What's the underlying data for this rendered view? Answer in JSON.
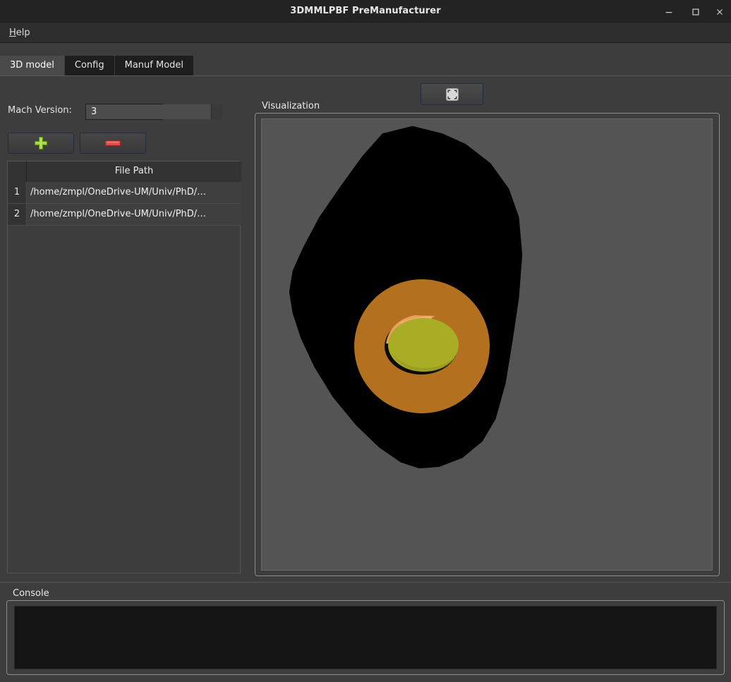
{
  "window": {
    "title": "3DMMLPBF PreManufacturer",
    "minimize_icon": "minimize-icon",
    "maximize_icon": "maximize-icon",
    "close_icon": "close-icon"
  },
  "menubar": {
    "items": [
      {
        "label": "Help",
        "mnemonic": "H",
        "rest": "elp"
      }
    ]
  },
  "tabs": [
    {
      "label": "3D model",
      "active": true
    },
    {
      "label": "Config",
      "active": false
    },
    {
      "label": "Manuf Model",
      "active": false
    }
  ],
  "left_panel": {
    "mach_version_label": "Mach Version:",
    "mach_version_value": "3",
    "mach_version_placeholder": "",
    "add_button": {
      "label": "",
      "icon": "plus-icon",
      "color": "#9fd636"
    },
    "remove_button": {
      "label": "",
      "icon": "minus-icon",
      "color": "#e04a4a"
    },
    "table": {
      "columns": [
        "",
        "File Path"
      ],
      "rows": [
        {
          "num": "1",
          "path": "/home/zmpl/OneDrive-UM/Univ/PhD/…"
        },
        {
          "num": "2",
          "path": "/home/zmpl/OneDrive-UM/Univ/PhD/…"
        }
      ]
    }
  },
  "toolbar": {
    "fit_view_button": {
      "label": "",
      "icon": "fit-view-icon"
    }
  },
  "visualization": {
    "legend": "Visualization",
    "viewport": {
      "background_color": "#545454",
      "model_color": "#000000",
      "bore_color": "#b3701f",
      "inner_face_color": "#a9ad26",
      "highlight_color": "#e8a15c",
      "shadow_color": "#0c0c06"
    }
  },
  "console": {
    "legend": "Console",
    "text": "",
    "placeholder": ""
  },
  "colors": {
    "window_background": "#3d3d3d",
    "titlebar_background": "#232323",
    "menubar_background": "#2d2d2d",
    "tab_inactive": "#1e1e1e",
    "tab_active": "#4a4a4a",
    "text_primary": "#e8e8e8",
    "groupbox_border": "#8d8d8d",
    "button_border": "#232b40",
    "console_background": "#141414"
  }
}
